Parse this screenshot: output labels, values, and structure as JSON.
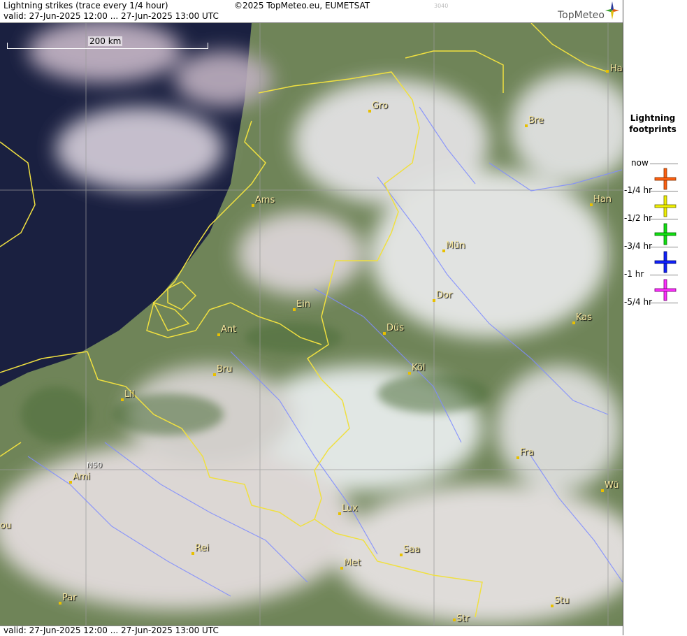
{
  "header": {
    "title": "Lightning strikes (trace every 1/4 hour)",
    "copyright": "©2025 TopMeteo.eu, EUMETSAT",
    "code": "3040",
    "valid": "valid:  27-Jun-2025 12:00 ... 27-Jun-2025 13:00 UTC",
    "brand": "TopMeteo"
  },
  "footer": {
    "valid": "valid:  27-Jun-2025 12:00 ... 27-Jun-2025 13:00 UTC"
  },
  "map": {
    "scale_label": "200 km",
    "lat_label": "N50",
    "cities": [
      {
        "id": "ha",
        "name": "Ha"
      },
      {
        "id": "gro",
        "name": "Gro"
      },
      {
        "id": "bre",
        "name": "Bre"
      },
      {
        "id": "ams",
        "name": "Ams"
      },
      {
        "id": "han",
        "name": "Han"
      },
      {
        "id": "mun",
        "name": "Mün"
      },
      {
        "id": "dor",
        "name": "Dor"
      },
      {
        "id": "ein",
        "name": "Ein"
      },
      {
        "id": "kas",
        "name": "Kas"
      },
      {
        "id": "ant",
        "name": "Ant"
      },
      {
        "id": "dus",
        "name": "Düs"
      },
      {
        "id": "bru",
        "name": "Bru"
      },
      {
        "id": "kol",
        "name": "Köl"
      },
      {
        "id": "lil",
        "name": "Lil"
      },
      {
        "id": "fra",
        "name": "Fra"
      },
      {
        "id": "ami",
        "name": "Ami"
      },
      {
        "id": "wu",
        "name": "Wü"
      },
      {
        "id": "lux",
        "name": "Lux"
      },
      {
        "id": "ou",
        "name": "ou"
      },
      {
        "id": "rei",
        "name": "Rei"
      },
      {
        "id": "saa",
        "name": "Saa"
      },
      {
        "id": "met",
        "name": "Met"
      },
      {
        "id": "stu",
        "name": "Stu"
      },
      {
        "id": "par",
        "name": "Par"
      },
      {
        "id": "str",
        "name": "Str"
      }
    ],
    "colors": {
      "border": "#f0e040",
      "river": "#7f8cff",
      "sea": "#1a2040",
      "land": "#5f7a48",
      "cloud": "#e6e2e6"
    }
  },
  "legend": {
    "title_line1": "Lightning",
    "title_line2": "footprints",
    "items": [
      {
        "label": "now",
        "color": "#ff6010",
        "icon": "cross-icon"
      },
      {
        "label": "-1/4 hr",
        "color": "#f0f000",
        "icon": "cross-icon"
      },
      {
        "label": "-1/2 hr",
        "color": "#10e010",
        "icon": "cross-icon"
      },
      {
        "label": "-3/4 hr",
        "color": "#1020ff",
        "icon": "cross-icon"
      },
      {
        "label": "-1 hr",
        "color": "#ff30ff",
        "icon": "cross-icon"
      },
      {
        "label": "-5/4 hr",
        "color": "",
        "icon": ""
      }
    ]
  }
}
